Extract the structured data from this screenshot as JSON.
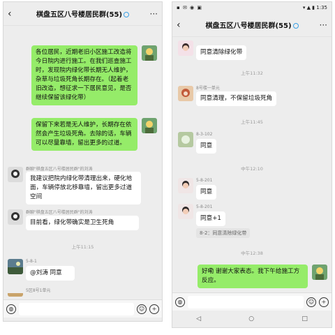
{
  "left": {
    "title": "棋盘五区八号楼居民群(55)",
    "back_icon": "‹",
    "more_icon": "···",
    "messages": [
      {
        "side": "right",
        "text": "各位居民，近期老旧小区施工改造将今日院内进行施工。在我们巡查施工时，发现院内绿化带长期无人维护，杂草与垃圾死角长期存在。（起着老旧改造，想征求一下居民意见，是否继续保留该绿化带）"
      },
      {
        "side": "right",
        "text": "保留下来若是无人维护，长期存在依然会产生垃圾死角。去除的话，车辆可以尽量靠墙，留出更多的过道。"
      },
      {
        "side": "left",
        "sender": "群聊\"棋盘五区八号楼居民群\"的刘涛",
        "text": "我建议把院内绿化带清理出来，硬化地面，车辆停放北移靠墙，留出更多过道空间"
      },
      {
        "side": "left",
        "sender": "群聊\"棋盘五区八号楼居民群\"的刘涛",
        "text": "目前看，绿化带确实是卫生死角"
      },
      {
        "side": "left",
        "sender": "5-8-1",
        "text": "@刘涛  同意"
      },
      {
        "side": "left",
        "sender": "5区8号1单元",
        "text": ""
      }
    ],
    "time": "上午11:15"
  },
  "right": {
    "status_time": "1:35",
    "title": "棋盘五区八号楼居民群(55)",
    "back_icon": "‹",
    "more_icon": "···",
    "messages": [
      {
        "side": "left",
        "sender": "",
        "text": "同意清除绿化带"
      },
      {
        "side": "left",
        "sender": "8号楼一单元",
        "text": "同意清理，不保留垃圾死角"
      },
      {
        "side": "left",
        "sender": "8-3-102",
        "text": "同意"
      },
      {
        "side": "left",
        "sender": "5-8-201",
        "text": "同意"
      },
      {
        "side": "left",
        "sender": "5-8-201",
        "text": "同意+1"
      },
      {
        "side": "right",
        "text": "好嘞 谢谢大家表态。我下午给施工方反应。"
      }
    ],
    "times": [
      "上午11:32",
      "上午11:45",
      "中午12:10",
      "中午12:38"
    ],
    "quote": "8-2：同意清除绿化带"
  },
  "input": {
    "voice_icon": "voice-icon",
    "emoji_icon": "emoji-icon",
    "plus_icon": "plus-icon"
  },
  "colors": {
    "green_bubble": "#95ec69",
    "white_bubble": "#ffffff",
    "bg": "#ededed"
  }
}
